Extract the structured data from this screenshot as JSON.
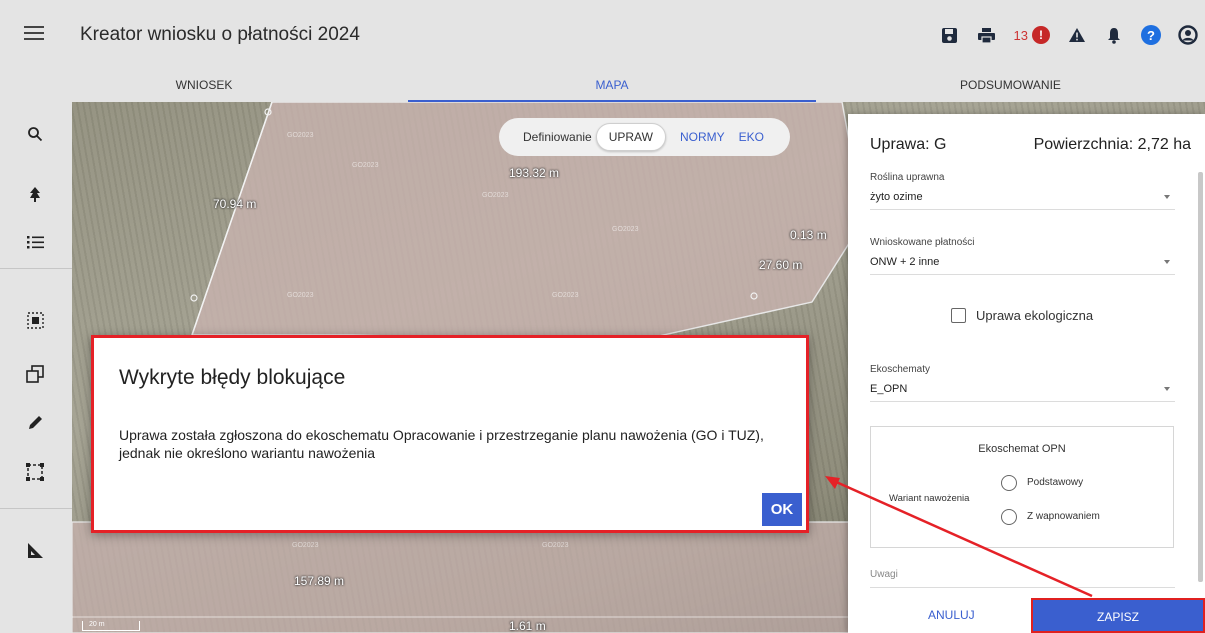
{
  "header": {
    "title": "Kreator wniosku o płatności 2024",
    "error_count": "13",
    "icons": [
      "menu-icon",
      "save-icon",
      "print-icon",
      "error-icon",
      "warning-icon",
      "bell-icon",
      "help-icon",
      "user-icon"
    ]
  },
  "tabs": [
    {
      "label": "WNIOSEK"
    },
    {
      "label": "MAPA",
      "active": true
    },
    {
      "label": "PODSUMOWANIE"
    }
  ],
  "tools": [
    "search-icon",
    "tree-icon",
    "list-icon",
    "select-icon",
    "copy-shape-icon",
    "pencil-icon",
    "dashed-rect-icon",
    "measure-icon"
  ],
  "map": {
    "measurements": [
      "70.94 m",
      "193.32 m",
      "0.13 m",
      "27.60 m",
      "157.89 m",
      "1.61 m"
    ],
    "watermark": "GO2023",
    "scale": "20 m",
    "segment_control": {
      "label": "Definiowanie",
      "options": [
        "UPRAW",
        "NORMY",
        "EKO"
      ],
      "selected": "UPRAW"
    }
  },
  "panel": {
    "uprawa": "Uprawa: G",
    "powierzchnia": "Powierzchnia: 2,72 ha",
    "roslina_label": "Roślina uprawna",
    "roslina_value": "żyto ozime",
    "platnosci_label": "Wnioskowane płatności",
    "platnosci_value": "ONW + 2 inne",
    "ekologiczna_label": "Uprawa ekologiczna",
    "ekoschematy_label": "Ekoschematy",
    "ekoschematy_value": "E_OPN",
    "opn_title": "Ekoschemat OPN",
    "wariant_label": "Wariant nawożenia",
    "option_1": "Podstawowy",
    "option_2": "Z wapnowaniem",
    "uwagi_label": "Uwagi",
    "cancel": "ANULUJ",
    "save": "ZAPISZ"
  },
  "dialog": {
    "title": "Wykryte błędy blokujące",
    "message": "Uprawa została zgłoszona do ekoschematu Opracowanie i przestrzeganie planu nawożenia (GO i TUZ), jednak nie określono wariantu nawożenia",
    "ok": "OK"
  },
  "colors": {
    "accent": "#3a5fcf",
    "highlight": "#e52127",
    "error": "#c62828",
    "help": "#1e6fe0"
  }
}
